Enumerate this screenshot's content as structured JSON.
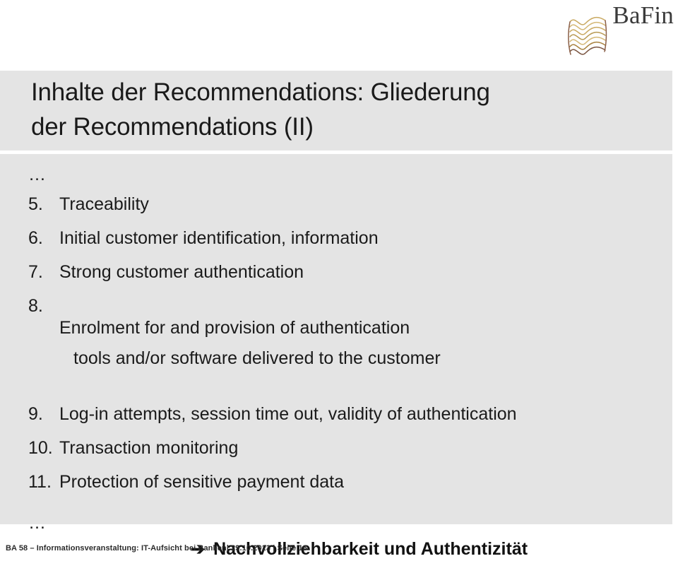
{
  "brand": {
    "name": "BaFin",
    "logo_icon": "bafin-wave-logo-icon",
    "wave_color_light": "#d9b96a",
    "wave_color_dark": "#6b4a3f"
  },
  "title": {
    "text": "Inhalte der Recommendations: Gliederung\nder Recommendations (II)"
  },
  "body": {
    "leading_ellipsis": "…",
    "trailing_ellipsis": "…",
    "items": [
      {
        "number": "5.",
        "text": "Traceability",
        "continuation": ""
      },
      {
        "number": "6.",
        "text": "Initial customer identification, information",
        "continuation": ""
      },
      {
        "number": "7.",
        "text": "Strong customer authentication",
        "continuation": ""
      },
      {
        "number": "8.",
        "text": "Enrolment for and provision of authentication",
        "continuation": "tools and/or software delivered to the customer"
      },
      {
        "number": "9.",
        "text": "Log-in attempts, session time out, validity of authentication",
        "continuation": ""
      },
      {
        "number": "10.",
        "text": "Transaction monitoring",
        "continuation": ""
      },
      {
        "number": "11.",
        "text": "Protection of sensitive payment data",
        "continuation": ""
      }
    ],
    "conclusion": {
      "arrow": "➔",
      "text": "Nachvollziehbarkeit und Authentizität"
    }
  },
  "footer": {
    "text": "BA 58 – Informationsveranstaltung: IT-Aufsicht bei Banken| 29.10.2013 | Seite 16"
  }
}
